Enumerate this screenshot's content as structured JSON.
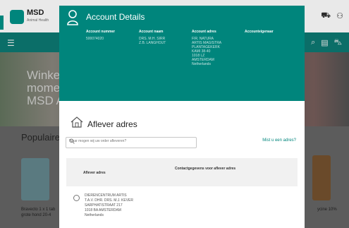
{
  "background": {
    "brand": "MSD",
    "brand_sub": "Animal Health",
    "hero_text_lines": [
      "Winkel",
      "momen",
      "MSD A"
    ],
    "section_title": "Populaire p",
    "left_product_lines": [
      "Bravecto 1 x 1 tab",
      "grote hond 20-4"
    ],
    "right_product_line": "ycine 10%"
  },
  "modal": {
    "title": "Account Details",
    "columns": [
      {
        "header": "Account nummer",
        "lines": [
          "500074020"
        ]
      },
      {
        "header": "Account naam",
        "lines": [
          "DRS. M.H. SIRR",
          "Z.B. LANGHOUT"
        ]
      },
      {
        "header": "Account adres",
        "lines": [
          "FIR. NATURA",
          "ARTIS MAGISTRA",
          "PLANTAGEKERK",
          "KAMI 38-40",
          "1018 LZ",
          "AMSTERDAM",
          "Netherlands"
        ]
      },
      {
        "header": "Accounteigenaar",
        "lines": []
      }
    ],
    "delivery_title": "Aflever adres",
    "search_placeholder": "Waar mogen wij uw order afleveren?",
    "new_address": "Mist u een adres?",
    "table_headers": {
      "col1": "Aflever adres",
      "col2": "Contactgegevens voor aflever adres"
    },
    "address_lines": [
      "DIERENCENTRUM ARTIS",
      "T.A.V. DHR. DRS. M.J. KEVER",
      "SARPHATISTRAAT 217",
      "1018 BA AMSTERDAM",
      "Netherlands"
    ]
  },
  "colors": {
    "accent": "#00857c"
  }
}
